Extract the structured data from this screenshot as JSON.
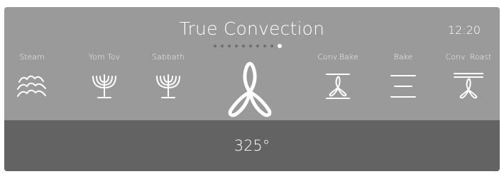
{
  "header": {
    "title": "True Convection",
    "clock": "12:20"
  },
  "pager": {
    "count": 10,
    "active_index": 9
  },
  "modes": [
    {
      "label": "Steam",
      "icon": "steam-icon"
    },
    {
      "label": "Yom Tov",
      "icon": "menorah-icon"
    },
    {
      "label": "Sabbath",
      "icon": "menorah-icon"
    },
    {
      "label": "True Convection",
      "icon": "convection-fan-icon",
      "selected": true
    },
    {
      "label": "Conv.Bake",
      "icon": "conv-bake-icon"
    },
    {
      "label": "Bake",
      "icon": "bake-icon"
    },
    {
      "label": "Conv. Roast",
      "icon": "conv-roast-icon"
    }
  ],
  "temperature": {
    "value": "325°"
  },
  "colors": {
    "panel": "#9a9a9a",
    "temp_bar": "#636363",
    "active_dot": "#ffffff",
    "inactive_dot": "#6f6f6f"
  }
}
